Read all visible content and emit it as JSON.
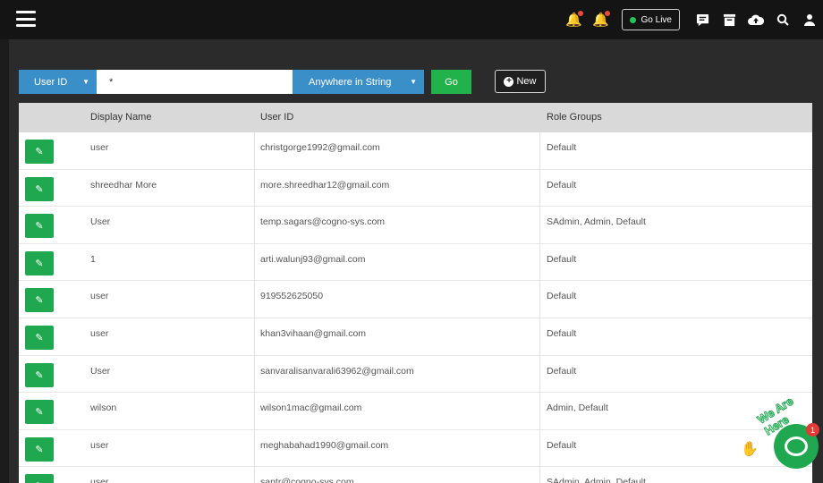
{
  "topbar": {
    "golive_label": "Go Live",
    "icons": [
      "menu-icon",
      "bell-icon",
      "bell-icon",
      "chat-list-icon",
      "inbox-icon",
      "cloud-upload-icon",
      "search-icon",
      "user-icon"
    ]
  },
  "search": {
    "field_select": "User ID",
    "query_value": "*",
    "mode_select": "Anywhere in String",
    "go_label": "Go",
    "new_label": "New"
  },
  "table": {
    "headers": [
      "Display Name",
      "User ID",
      "Role Groups"
    ],
    "rows": [
      {
        "name": "user",
        "user_id": "christgorge1992@gmail.com",
        "roles": "Default"
      },
      {
        "name": "shreedhar More",
        "user_id": "more.shreedhar12@gmail.com",
        "roles": "Default"
      },
      {
        "name": "User",
        "user_id": "temp.sagars@cogno-sys.com",
        "roles": "SAdmin, Admin, Default"
      },
      {
        "name": "1",
        "user_id": "arti.walunj93@gmail.com",
        "roles": "Default"
      },
      {
        "name": "user",
        "user_id": "919552625050",
        "roles": "Default"
      },
      {
        "name": "user",
        "user_id": "khan3vihaan@gmail.com",
        "roles": "Default"
      },
      {
        "name": "User",
        "user_id": "sanvaralisanvarali63962@gmail.com",
        "roles": "Default"
      },
      {
        "name": "wilson",
        "user_id": "wilson1mac@gmail.com",
        "roles": "Admin, Default"
      },
      {
        "name": "user",
        "user_id": "meghabahad1990@gmail.com",
        "roles": "Default"
      },
      {
        "name": "user",
        "user_id": "santr@cogno-sys.com",
        "roles": "SAdmin, Admin, Default"
      }
    ]
  },
  "chat": {
    "tagline": "We Are Here",
    "badge_count": "1"
  },
  "colors": {
    "accent_blue": "#3b8fc9",
    "accent_green": "#21b24b",
    "topbar_bg": "#141414"
  }
}
